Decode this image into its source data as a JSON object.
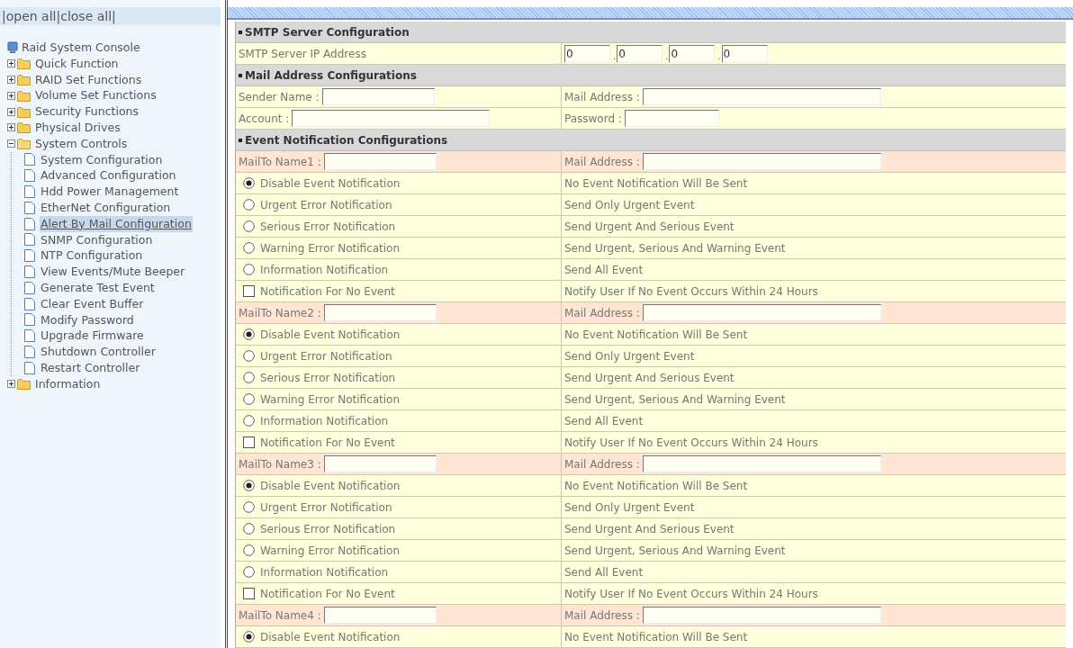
{
  "sidebar": {
    "link_bar": "|open all|close all|",
    "tree": {
      "label": "Raid System Console",
      "children": [
        {
          "label": "Quick Function",
          "expanded": false
        },
        {
          "label": "RAID Set Functions",
          "expanded": false
        },
        {
          "label": "Volume Set Functions",
          "expanded": false
        },
        {
          "label": "Security Functions",
          "expanded": false
        },
        {
          "label": "Physical Drives",
          "expanded": false
        },
        {
          "label": "System Controls",
          "expanded": true,
          "children": [
            {
              "label": "System Configuration",
              "selected": false
            },
            {
              "label": "Advanced Configuration",
              "selected": false
            },
            {
              "label": "Hdd Power Management",
              "selected": false
            },
            {
              "label": "EtherNet Configuration",
              "selected": false
            },
            {
              "label": "Alert By Mail Configuration",
              "selected": true
            },
            {
              "label": "SNMP Configuration",
              "selected": false
            },
            {
              "label": "NTP Configuration",
              "selected": false
            },
            {
              "label": "View Events/Mute Beeper",
              "selected": false
            },
            {
              "label": "Generate Test Event",
              "selected": false
            },
            {
              "label": "Clear Event Buffer",
              "selected": false
            },
            {
              "label": "Modify Password",
              "selected": false
            },
            {
              "label": "Upgrade Firmware",
              "selected": false
            },
            {
              "label": "Shutdown Controller",
              "selected": false
            },
            {
              "label": "Restart Controller",
              "selected": false
            }
          ]
        },
        {
          "label": "Information",
          "expanded": false
        }
      ]
    }
  },
  "sections": [
    {
      "title": "SMTP Server Configuration",
      "rows": [
        {
          "kind": "ip",
          "label": "SMTP Server IP Address",
          "octets": [
            "0",
            "0",
            "0",
            "0"
          ],
          "separator": "."
        }
      ]
    },
    {
      "title": "Mail Address Configurations",
      "rows": [
        {
          "kind": "fields",
          "cells": [
            {
              "label": "Sender Name :",
              "kind": "name"
            },
            {
              "label": "Mail Address :",
              "kind": "address"
            }
          ]
        },
        {
          "kind": "fields",
          "cells": [
            {
              "label": "Account :",
              "kind": "account"
            },
            {
              "label": "Password :",
              "kind": "password"
            }
          ]
        }
      ]
    },
    {
      "title": "Event Notification Configurations",
      "rows": [
        {
          "kind": "recipient",
          "cells": [
            {
              "label": "MailTo Name1 :",
              "kind": "name"
            },
            {
              "label": "Mail Address :",
              "kind": "address"
            }
          ]
        },
        {
          "kind": "radio",
          "label": "Disable Event Notification",
          "description": "No Event Notification Will Be Sent",
          "selected": true
        },
        {
          "kind": "radio",
          "label": "Urgent Error Notification",
          "description": "Send Only Urgent Event",
          "selected": false
        },
        {
          "kind": "radio",
          "label": "Serious Error Notification",
          "description": "Send Urgent And Serious Event",
          "selected": false
        },
        {
          "kind": "radio",
          "label": "Warning Error Notification",
          "description": "Send Urgent, Serious And Warning Event",
          "selected": false
        },
        {
          "kind": "radio",
          "label": "Information Notification",
          "description": "Send All Event",
          "selected": false
        },
        {
          "kind": "checkbox",
          "label": "Notification For No Event",
          "description": "Notify User If No Event Occurs Within 24 Hours",
          "checked": false
        },
        {
          "kind": "recipient",
          "cells": [
            {
              "label": "MailTo Name2 :",
              "kind": "name"
            },
            {
              "label": "Mail Address :",
              "kind": "address"
            }
          ]
        },
        {
          "kind": "radio",
          "label": "Disable Event Notification",
          "description": "No Event Notification Will Be Sent",
          "selected": true
        },
        {
          "kind": "radio",
          "label": "Urgent Error Notification",
          "description": "Send Only Urgent Event",
          "selected": false
        },
        {
          "kind": "radio",
          "label": "Serious Error Notification",
          "description": "Send Urgent And Serious Event",
          "selected": false
        },
        {
          "kind": "radio",
          "label": "Warning Error Notification",
          "description": "Send Urgent, Serious And Warning Event",
          "selected": false
        },
        {
          "kind": "radio",
          "label": "Information Notification",
          "description": "Send All Event",
          "selected": false
        },
        {
          "kind": "checkbox",
          "label": "Notification For No Event",
          "description": "Notify User If No Event Occurs Within 24 Hours",
          "checked": false
        },
        {
          "kind": "recipient",
          "cells": [
            {
              "label": "MailTo Name3 :",
              "kind": "name"
            },
            {
              "label": "Mail Address :",
              "kind": "address"
            }
          ]
        },
        {
          "kind": "radio",
          "label": "Disable Event Notification",
          "description": "No Event Notification Will Be Sent",
          "selected": true
        },
        {
          "kind": "radio",
          "label": "Urgent Error Notification",
          "description": "Send Only Urgent Event",
          "selected": false
        },
        {
          "kind": "radio",
          "label": "Serious Error Notification",
          "description": "Send Urgent And Serious Event",
          "selected": false
        },
        {
          "kind": "radio",
          "label": "Warning Error Notification",
          "description": "Send Urgent, Serious And Warning Event",
          "selected": false
        },
        {
          "kind": "radio",
          "label": "Information Notification",
          "description": "Send All Event",
          "selected": false
        },
        {
          "kind": "checkbox",
          "label": "Notification For No Event",
          "description": "Notify User If No Event Occurs Within 24 Hours",
          "checked": false
        },
        {
          "kind": "recipient",
          "cells": [
            {
              "label": "MailTo Name4 :",
              "kind": "name"
            },
            {
              "label": "Mail Address :",
              "kind": "address"
            }
          ]
        },
        {
          "kind": "radio",
          "label": "Disable Event Notification",
          "description": "No Event Notification Will Be Sent",
          "selected": true
        }
      ]
    }
  ]
}
